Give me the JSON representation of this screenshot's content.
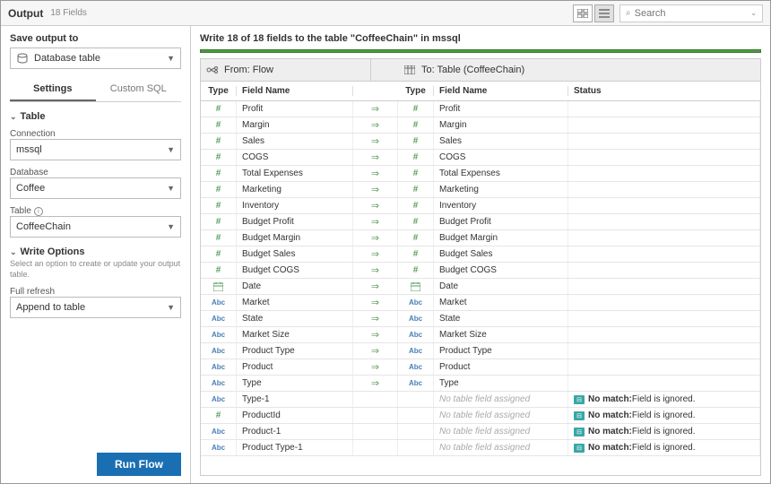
{
  "header": {
    "title": "Output",
    "subtitle": "18 Fields",
    "search_placeholder": "Search"
  },
  "sidebar": {
    "save_label": "Save output to",
    "save_value": "Database table",
    "tabs": {
      "settings": "Settings",
      "custom_sql": "Custom SQL"
    },
    "table_section": "Table",
    "connection_label": "Connection",
    "connection_value": "mssql",
    "database_label": "Database",
    "database_value": "Coffee",
    "table_label": "Table",
    "table_value": "CoffeeChain",
    "write_section": "Write Options",
    "write_help": "Select an option to create or update your output table.",
    "refresh_label": "Full refresh",
    "refresh_value": "Append to table",
    "run_btn": "Run Flow"
  },
  "content": {
    "description": "Write 18 of 18 fields to the table \"CoffeeChain\" in mssql",
    "from_label": "From: Flow",
    "to_label": "To: Table (CoffeeChain)",
    "col_type": "Type",
    "col_field": "Field Name",
    "col_status": "Status",
    "no_assign": "No table field assigned",
    "status_nomatch_b": "No match:",
    "status_nomatch_r": " Field is ignored.",
    "rows": [
      {
        "lt": "num",
        "ln": "Profit",
        "map": true,
        "rt": "num",
        "rn": "Profit"
      },
      {
        "lt": "num",
        "ln": "Margin",
        "map": true,
        "rt": "num",
        "rn": "Margin"
      },
      {
        "lt": "num",
        "ln": "Sales",
        "map": true,
        "rt": "num",
        "rn": "Sales"
      },
      {
        "lt": "num",
        "ln": "COGS",
        "map": true,
        "rt": "num",
        "rn": "COGS"
      },
      {
        "lt": "num",
        "ln": "Total Expenses",
        "map": true,
        "rt": "num",
        "rn": "Total Expenses"
      },
      {
        "lt": "num",
        "ln": "Marketing",
        "map": true,
        "rt": "num",
        "rn": "Marketing"
      },
      {
        "lt": "num",
        "ln": "Inventory",
        "map": true,
        "rt": "num",
        "rn": "Inventory"
      },
      {
        "lt": "num",
        "ln": "Budget Profit",
        "map": true,
        "rt": "num",
        "rn": "Budget Profit"
      },
      {
        "lt": "num",
        "ln": "Budget Margin",
        "map": true,
        "rt": "num",
        "rn": "Budget Margin"
      },
      {
        "lt": "num",
        "ln": "Budget Sales",
        "map": true,
        "rt": "num",
        "rn": "Budget Sales"
      },
      {
        "lt": "num",
        "ln": "Budget COGS",
        "map": true,
        "rt": "num",
        "rn": "Budget COGS"
      },
      {
        "lt": "date",
        "ln": "Date",
        "map": true,
        "rt": "date",
        "rn": "Date"
      },
      {
        "lt": "abc",
        "ln": "Market",
        "map": true,
        "rt": "abc",
        "rn": "Market"
      },
      {
        "lt": "abc",
        "ln": "State",
        "map": true,
        "rt": "abc",
        "rn": "State"
      },
      {
        "lt": "abc",
        "ln": "Market Size",
        "map": true,
        "rt": "abc",
        "rn": "Market Size"
      },
      {
        "lt": "abc",
        "ln": "Product Type",
        "map": true,
        "rt": "abc",
        "rn": "Product Type"
      },
      {
        "lt": "abc",
        "ln": "Product",
        "map": true,
        "rt": "abc",
        "rn": "Product"
      },
      {
        "lt": "abc",
        "ln": "Type",
        "map": true,
        "rt": "abc",
        "rn": "Type"
      },
      {
        "lt": "abc",
        "ln": "Type-1",
        "map": false
      },
      {
        "lt": "num",
        "ln": "ProductId",
        "map": false
      },
      {
        "lt": "abc",
        "ln": "Product-1",
        "map": false
      },
      {
        "lt": "abc",
        "ln": "Product Type-1",
        "map": false
      }
    ]
  }
}
